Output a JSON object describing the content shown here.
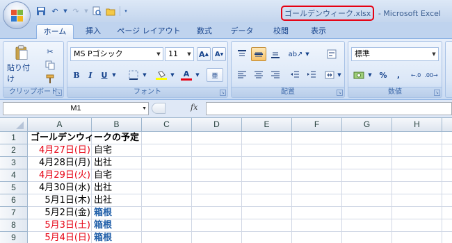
{
  "title_bar": {
    "file_name": "ゴールデンウィーク.xlsx",
    "app_name": "- Microsoft Excel"
  },
  "tabs": [
    "ホーム",
    "挿入",
    "ページ レイアウト",
    "数式",
    "データ",
    "校閲",
    "表示"
  ],
  "active_tab": "ホーム",
  "ribbon": {
    "clipboard": {
      "paste_label": "貼り付け",
      "group_label": "クリップボード"
    },
    "font": {
      "font_name": "MS Pゴシック",
      "font_size": "11",
      "group_label": "フォント"
    },
    "alignment": {
      "group_label": "配置"
    },
    "number": {
      "format": "標準",
      "group_label": "数値"
    }
  },
  "formula_bar": {
    "name_box": "M1",
    "fx_label": "fx",
    "formula": ""
  },
  "sheet": {
    "columns": [
      "A",
      "B",
      "C",
      "D",
      "E",
      "F",
      "G",
      "H"
    ],
    "rows": [
      {
        "num": "1",
        "a": "ゴールデンウィークの予定",
        "b": "",
        "a_style": "bold",
        "b_style": ""
      },
      {
        "num": "2",
        "a": "4月27日(日)",
        "b": "自宅",
        "a_style": "red",
        "b_style": ""
      },
      {
        "num": "3",
        "a": "4月28日(月)",
        "b": "出社",
        "a_style": "",
        "b_style": ""
      },
      {
        "num": "4",
        "a": "4月29日(火)",
        "b": "自宅",
        "a_style": "red",
        "b_style": ""
      },
      {
        "num": "5",
        "a": "4月30日(水)",
        "b": "出社",
        "a_style": "",
        "b_style": ""
      },
      {
        "num": "6",
        "a": "5月1日(木)",
        "b": "出社",
        "a_style": "",
        "b_style": ""
      },
      {
        "num": "7",
        "a": "5月2日(金)",
        "b": "箱根",
        "a_style": "",
        "b_style": "blue"
      },
      {
        "num": "8",
        "a": "5月3日(土)",
        "b": "箱根",
        "a_style": "red",
        "b_style": "blue"
      },
      {
        "num": "9",
        "a": "5月4日(日)",
        "b": "箱根",
        "a_style": "red",
        "b_style": "blue"
      }
    ]
  },
  "colors": {
    "highlight_box": "#e60012",
    "holiday_red": "#e60012",
    "link_blue": "#1f5ea8"
  }
}
